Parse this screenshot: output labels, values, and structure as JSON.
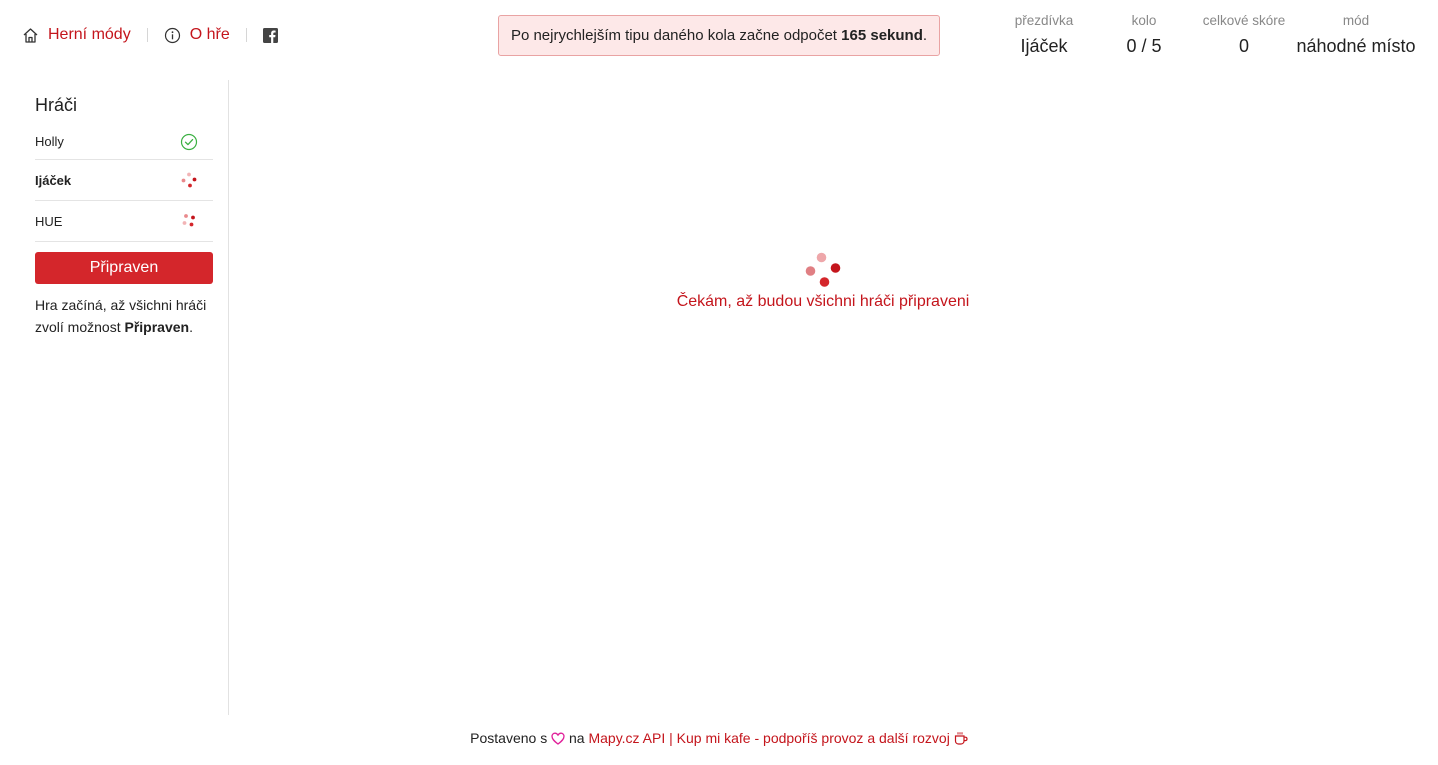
{
  "nav": {
    "home_label": "Herní módy",
    "about_label": "O hře",
    "icons": [
      "home-icon",
      "info-icon",
      "facebook-icon"
    ]
  },
  "notice": {
    "text_before": "Po nejrychlejším tipu daného kola začne odpočet ",
    "text_bold": "165 sekund",
    "text_after": "."
  },
  "stats": {
    "nickname_label": "přezdívka",
    "nickname_value": "Ijáček",
    "round_label": "kolo",
    "round_value": "0 / 5",
    "score_label": "celkové skóre",
    "score_value": "0",
    "mode_label": "mód",
    "mode_value": "náhodné místo"
  },
  "sidebar": {
    "title": "Hráči",
    "players": [
      {
        "name": "Holly",
        "status": "ready"
      },
      {
        "name": "Ijáček",
        "status": "waiting"
      },
      {
        "name": "HUE",
        "status": "waiting"
      }
    ],
    "ready_button": "Připraven",
    "hint_before": "Hra začíná, až všichni hráči zvolí možnost ",
    "hint_bold": "Připraven",
    "hint_after": "."
  },
  "main": {
    "waiting_text": "Čekám, až budou všichni hráči připraveni"
  },
  "footer": {
    "built_text": "Postaveno s ",
    "on_text": " na ",
    "api_link": "Mapy.cz API",
    "separator": " | ",
    "coffee_link": "Kup mi kafe - podpoříš provoz a další rozvoj"
  },
  "colors": {
    "accent": "#c4151c",
    "button": "#d4262b",
    "notice_bg": "#fde8e8",
    "notice_border": "#e9a3a3",
    "ready_green": "#3cb043"
  }
}
